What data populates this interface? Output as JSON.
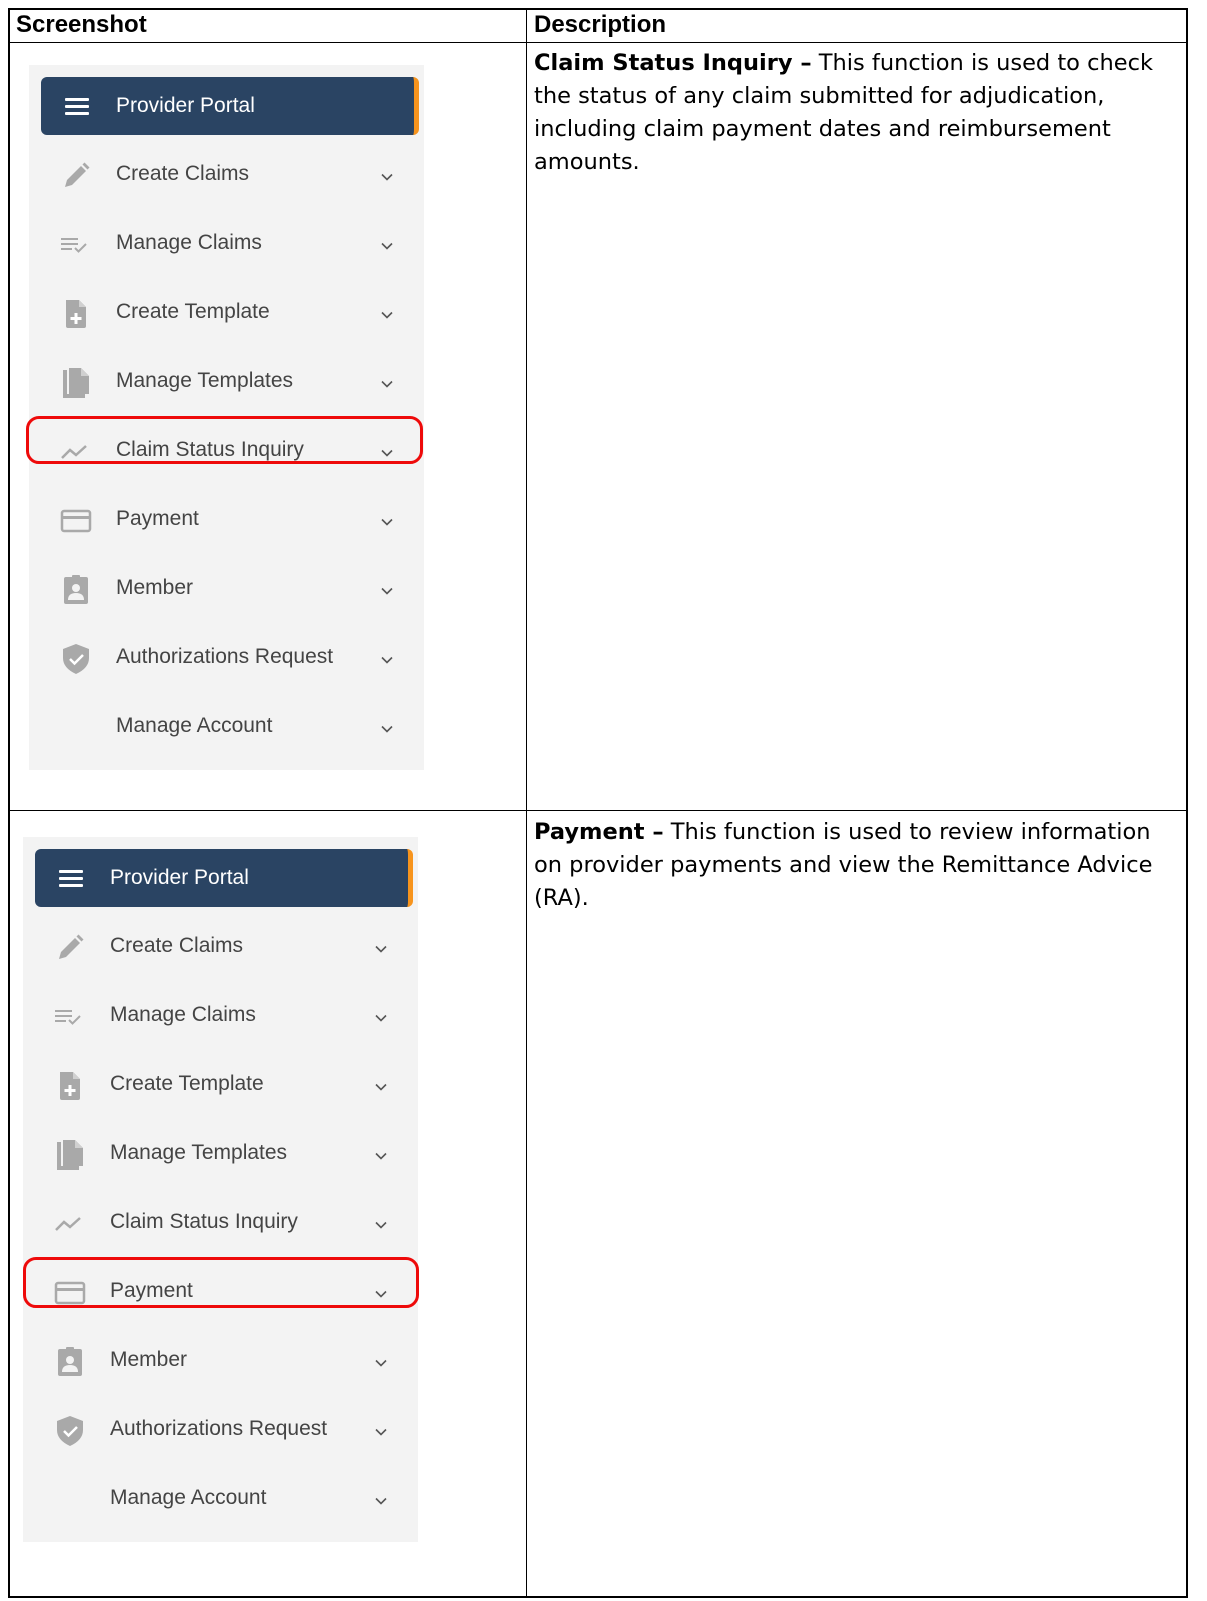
{
  "table": {
    "header_screenshot": "Screenshot",
    "header_description": "Description"
  },
  "portal": {
    "title": "Provider Portal",
    "accent_color": "#f7941d",
    "header_color": "#2a4463",
    "items": [
      {
        "label": "Create Claims",
        "icon": "pencil-icon"
      },
      {
        "label": "Manage Claims",
        "icon": "checklist-icon"
      },
      {
        "label": "Create Template",
        "icon": "file-add-icon"
      },
      {
        "label": "Manage Templates",
        "icon": "files-icon"
      },
      {
        "label": "Claim Status Inquiry",
        "icon": "trend-line-icon"
      },
      {
        "label": "Payment",
        "icon": "credit-card-icon"
      },
      {
        "label": "Member",
        "icon": "member-badge-icon"
      },
      {
        "label": "Authorizations Request",
        "icon": "shield-check-icon"
      },
      {
        "label": "Manage Account",
        "icon": ""
      }
    ]
  },
  "rows": [
    {
      "highlighted_item": "Claim Status Inquiry",
      "title": "Claim Status Inquiry –",
      "text": " This function is used to check the status of any claim submitted for adjudication, including claim payment dates and reimbursement amounts."
    },
    {
      "highlighted_item": "Payment",
      "title": "Payment –",
      "text": " This function is used to review information on provider payments and view the Remittance Advice (RA)."
    }
  ],
  "highlight_color": "#ee0a0a"
}
